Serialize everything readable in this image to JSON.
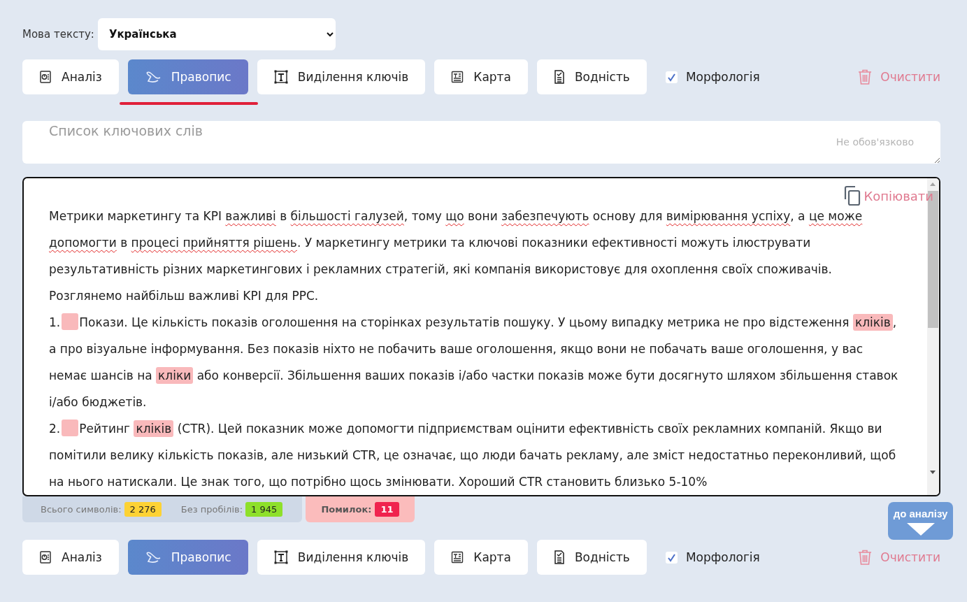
{
  "language": {
    "label": "Мова тексту:",
    "value": "Українська"
  },
  "toolbar_top": {
    "underline_selected": true,
    "buttons": [
      {
        "kind": "analysis",
        "label": "Аналіз",
        "selected": false
      },
      {
        "kind": "spelling",
        "label": "Правопис",
        "selected": true
      },
      {
        "kind": "keys",
        "label": "Виділення ключів",
        "selected": false
      },
      {
        "kind": "map",
        "label": "Карта",
        "selected": false
      },
      {
        "kind": "water",
        "label": "Водність",
        "selected": false
      }
    ],
    "morphology": {
      "label": "Морфологія",
      "checked": true
    },
    "clear": "Очистити"
  },
  "keywords": {
    "placeholder": "Список ключових слів",
    "hint": "Не обов'язково"
  },
  "editor": {
    "copy": "Копіювати",
    "paragraphs": [
      [
        {
          "kind": "plain",
          "text": "Метрики маркетингу та KPI "
        },
        {
          "kind": "error",
          "text": "важливі"
        },
        {
          "kind": "plain",
          "text": " в "
        },
        {
          "kind": "error",
          "text": "більшості галузей"
        },
        {
          "kind": "plain",
          "text": ", тому "
        },
        {
          "kind": "error",
          "text": "що"
        },
        {
          "kind": "plain",
          "text": " вони "
        },
        {
          "kind": "error",
          "text": "забезпечують"
        },
        {
          "kind": "plain",
          "text": " основу для "
        },
        {
          "kind": "error",
          "text": "вимірювання успіху"
        },
        {
          "kind": "plain",
          "text": ", а "
        },
        {
          "kind": "error",
          "text": "це може допомогти"
        },
        {
          "kind": "plain",
          "text": " в "
        },
        {
          "kind": "error",
          "text": "процесі прийняття рішень"
        },
        {
          "kind": "plain",
          "text": ". У маркетингу метрики та ключові показники ефективності можуть ілюструвати результативність різних маркетингових і рекламних стратегій, які компанія використовує для охоплення своїх споживачів. Розглянемо найбільш важливі KPI для PPC."
        }
      ],
      [
        {
          "kind": "plain",
          "text": "1."
        },
        {
          "kind": "gap"
        },
        {
          "kind": "plain",
          "text": "Покази. Це кількість показів оголошення на сторінках результатів пошуку. У цьому випадку метрика не про відстеження "
        },
        {
          "kind": "highlight",
          "text": "кліків"
        },
        {
          "kind": "plain",
          "text": ", а про візуальне інформування. Без показів ніхто не побачить ваше оголошення, якщо вони не побачать ваше оголошення, у вас немає шансів на "
        },
        {
          "kind": "highlight",
          "text": "кліки"
        },
        {
          "kind": "plain",
          "text": " або конверсії. Збільшення ваших показів і/або частки показів може бути досягнуто шляхом збільшення ставок і/або бюджетів."
        }
      ],
      [
        {
          "kind": "plain",
          "text": "2."
        },
        {
          "kind": "gap"
        },
        {
          "kind": "plain",
          "text": "Рейтинг "
        },
        {
          "kind": "highlight",
          "text": "кліків"
        },
        {
          "kind": "plain",
          "text": " (CTR). Цей показник може допомогти підприємствам оцінити ефективність своїх рекламних компаній. Якщо ви помітили велику кількість показів, але низький CTR, це означає, що люди бачать рекламу, але зміст недостатньо переконливий, щоб на нього натискали. Це знак того, що потрібно щось змінювати. Хороший CTR становить близько 5-10%"
        }
      ]
    ]
  },
  "stats": {
    "total_label": "Всього символів:",
    "total": "2 276",
    "nospace_label": "Без пробілів:",
    "nospace": "1 945",
    "errors_label": "Помилок:",
    "errors": "11"
  },
  "to_analysis": "до аналізу",
  "toolbar_bottom": {
    "buttons": [
      {
        "kind": "analysis",
        "label": "Аналіз",
        "selected": false
      },
      {
        "kind": "spelling",
        "label": "Правопис",
        "selected": true
      },
      {
        "kind": "keys",
        "label": "Виділення ключів",
        "selected": false
      },
      {
        "kind": "map",
        "label": "Карта",
        "selected": false
      },
      {
        "kind": "water",
        "label": "Водність",
        "selected": false
      }
    ],
    "morphology": {
      "label": "Морфологія",
      "checked": true
    },
    "clear": "Очистити"
  }
}
